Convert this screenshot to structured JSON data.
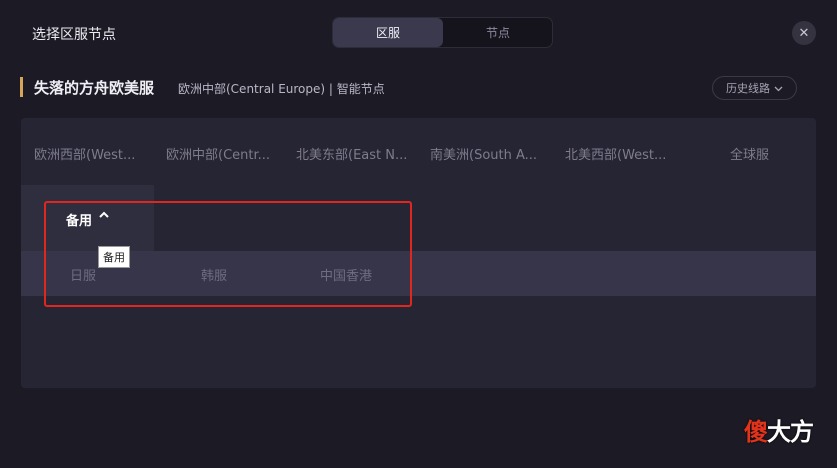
{
  "header": {
    "title": "选择区服节点",
    "tabs": [
      {
        "label": "区服",
        "active": true
      },
      {
        "label": "节点",
        "active": false
      }
    ],
    "close_icon": "close-icon"
  },
  "game": {
    "name": "失落的方舟欧美服",
    "subtitle": "欧洲中部(Central Europe) | 智能节点",
    "accent_color": "#d6a55a",
    "history_label": "历史线路"
  },
  "regions": [
    {
      "label": "欧洲西部(West..."
    },
    {
      "label": "欧洲中部(Centr..."
    },
    {
      "label": "北美东部(East N..."
    },
    {
      "label": "南美洲(South A..."
    },
    {
      "label": "北美西部(West..."
    },
    {
      "label": "全球服"
    }
  ],
  "backup": {
    "label": "备用",
    "tooltip": "备用",
    "items": [
      {
        "label": "日服"
      },
      {
        "label": "韩服"
      },
      {
        "label": "中国香港"
      }
    ]
  },
  "watermark": {
    "first_char": "傻",
    "rest": "大方"
  },
  "colors": {
    "highlight_border": "#e0261f",
    "background": "#1c1b25",
    "panel": "#262533"
  }
}
